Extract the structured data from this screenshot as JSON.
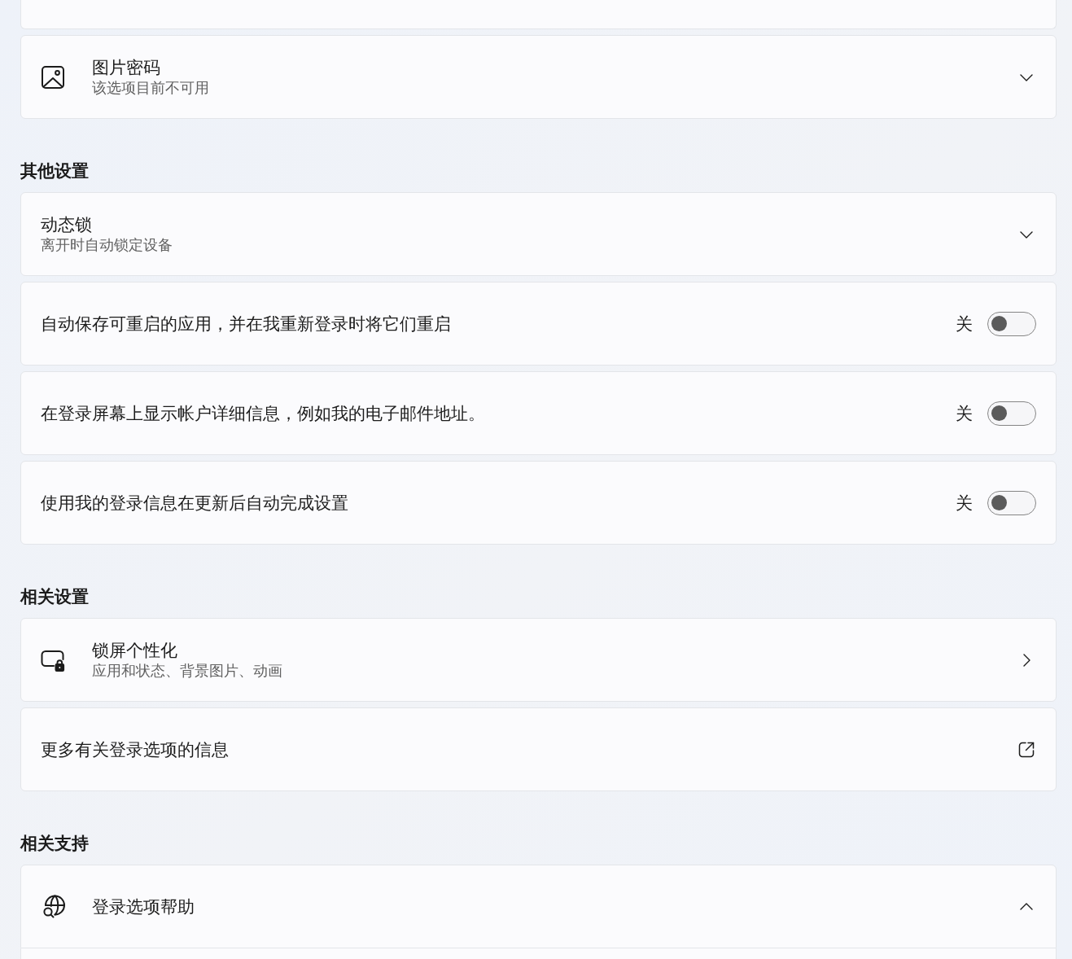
{
  "sections": [
    {
      "cards": [
        {
          "kind": "clipped"
        },
        {
          "kind": "expander",
          "title": "图片密码",
          "description": "该选项目前不可用",
          "expanded": false
        }
      ]
    },
    {
      "heading": "其他设置",
      "cards": [
        {
          "kind": "expander",
          "title": "动态锁",
          "description": "离开时自动锁定设备",
          "expanded": false
        },
        {
          "kind": "toggle",
          "title": "自动保存可重启的应用，并在我重新登录时将它们重启",
          "state_label": "关",
          "on": false
        },
        {
          "kind": "toggle",
          "title": "在登录屏幕上显示帐户详细信息，例如我的电子邮件地址。",
          "state_label": "关",
          "on": false
        },
        {
          "kind": "toggle",
          "title": "使用我的登录信息在更新后自动完成设置",
          "state_label": "关",
          "on": false
        }
      ]
    },
    {
      "heading": "相关设置",
      "cards": [
        {
          "kind": "link",
          "title": "锁屏个性化",
          "description": "应用和状态、背景图片、动画"
        },
        {
          "kind": "external_link",
          "title": "更多有关登录选项的信息"
        }
      ]
    },
    {
      "heading": "相关支持",
      "cards": [
        {
          "kind": "expander",
          "title": "登录选项帮助",
          "expanded": true
        }
      ]
    }
  ]
}
